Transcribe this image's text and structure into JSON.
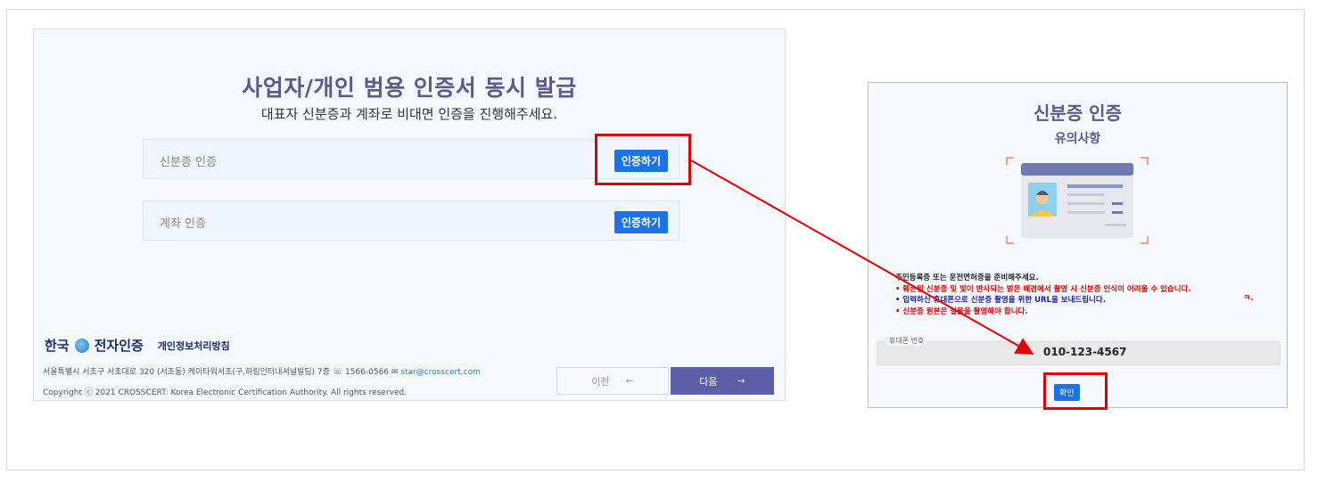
{
  "left_page": {
    "title": "사업자/개인 범용 인증서 동시 발급",
    "subtitle": "대표자 신분증과 계좌로 비대면 인증을 진행해주세요.",
    "rows": [
      {
        "label": "신분증 인증",
        "button": "인증하기"
      },
      {
        "label": "계좌 인증",
        "button": "인증하기"
      }
    ],
    "footer": {
      "logo_text_left": "한국",
      "logo_text_right": "전자인증",
      "privacy_link": "개인정보처리방침",
      "address": "서울특별시 서초구 서초대로 320 (서초동) 케이타워서초(구.하림인터내셔널빌딩) 7층",
      "phone": "1566-0566",
      "email": "star@crosscert.com",
      "copyright": "Copyright ⓒ 2021 CROSSCERT: Korea Electronic Certification Authority. All rights reserved."
    },
    "prev_button": "이전",
    "next_button": "다음"
  },
  "right_panel": {
    "title": "신분증 인증",
    "subtitle": "유의사항",
    "notes": [
      "주민등록증 또는 운전면허증을 준비해주세요.",
      "• 훼손된 신분증 및 빛이 반사되는 밝은 배경에서 촬영 시 신분증 인식이 어려울 수 있습니다.",
      "• 입력하신 휴대폰으로 신분증 촬영을 위한 URL을 보내드립니다.",
      "• 신분증 원본은 실물을 촬영해야 합니다."
    ],
    "stray_text": "ㅋ.",
    "phone_label": "휴대폰 번호",
    "phone_value": "010-123-4567",
    "confirm_button": "확인"
  },
  "colors": {
    "accent_blue": "#1a73e8",
    "title_purple": "#5a5a8c",
    "highlight_red": "#e00000",
    "next_button_bg": "#5b5fa8"
  },
  "icons": [
    "id-card-illustration",
    "arrow-left-icon",
    "arrow-right-icon",
    "phone-icon",
    "mail-icon"
  ]
}
